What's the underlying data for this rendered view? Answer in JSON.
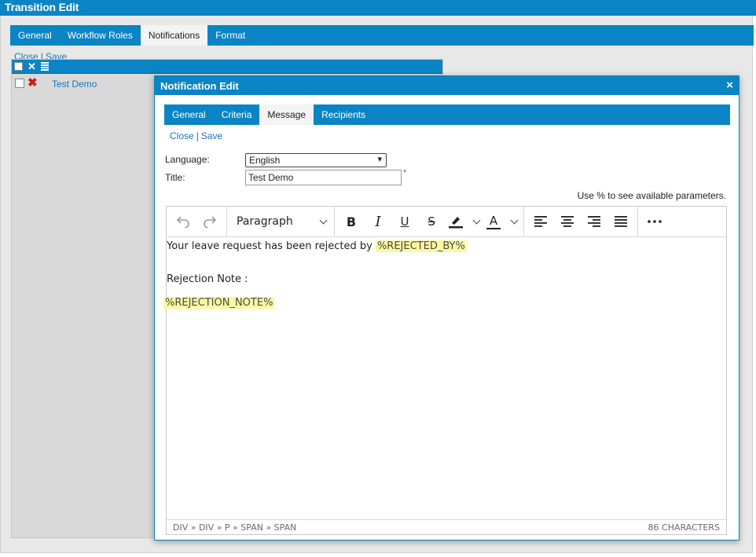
{
  "window": {
    "title": "Transition Edit",
    "tabs": [
      "General",
      "Workflow Roles",
      "Notifications",
      "Format"
    ],
    "active_tab": "Notifications",
    "actions": {
      "close": "Close",
      "save": "Save",
      "separator": "|"
    }
  },
  "grid": {
    "rows": [
      {
        "name": "Test Demo"
      }
    ]
  },
  "modal": {
    "title": "Notification Edit",
    "close_icon": "×",
    "tabs": [
      "General",
      "Criteria",
      "Message",
      "Recipients"
    ],
    "active_tab": "Message",
    "actions": {
      "close": "Close",
      "save": "Save",
      "separator": "|"
    },
    "form": {
      "language_label": "Language:",
      "language_value": "English",
      "title_label": "Title:",
      "title_value": "Test Demo",
      "required_marker": "*"
    },
    "hint": "Use % to see available parameters."
  },
  "editor": {
    "block_format": "Paragraph",
    "toolbar_icons": [
      "undo-icon",
      "redo-icon",
      "bold-icon",
      "italic-icon",
      "underline-icon",
      "strikethrough-icon",
      "highlight-icon",
      "text-color-icon",
      "align-left-icon",
      "align-center-icon",
      "align-right-icon",
      "align-justify-icon",
      "more-icon"
    ],
    "content": {
      "line1_text": "Your leave request has been rejected by ",
      "line1_param": "%REJECTED_BY%",
      "line2_text": "Rejection Note :",
      "line3_param": "%REJECTION_NOTE%"
    },
    "status_path": "DIV » DIV » P » SPAN » SPAN",
    "char_count": "86 CHARACTERS"
  },
  "colors": {
    "header_blue": "#0a84c4",
    "link_blue": "#1a76b8",
    "highlight": "#fbf8a0",
    "delete_red": "#cc1a1a"
  }
}
